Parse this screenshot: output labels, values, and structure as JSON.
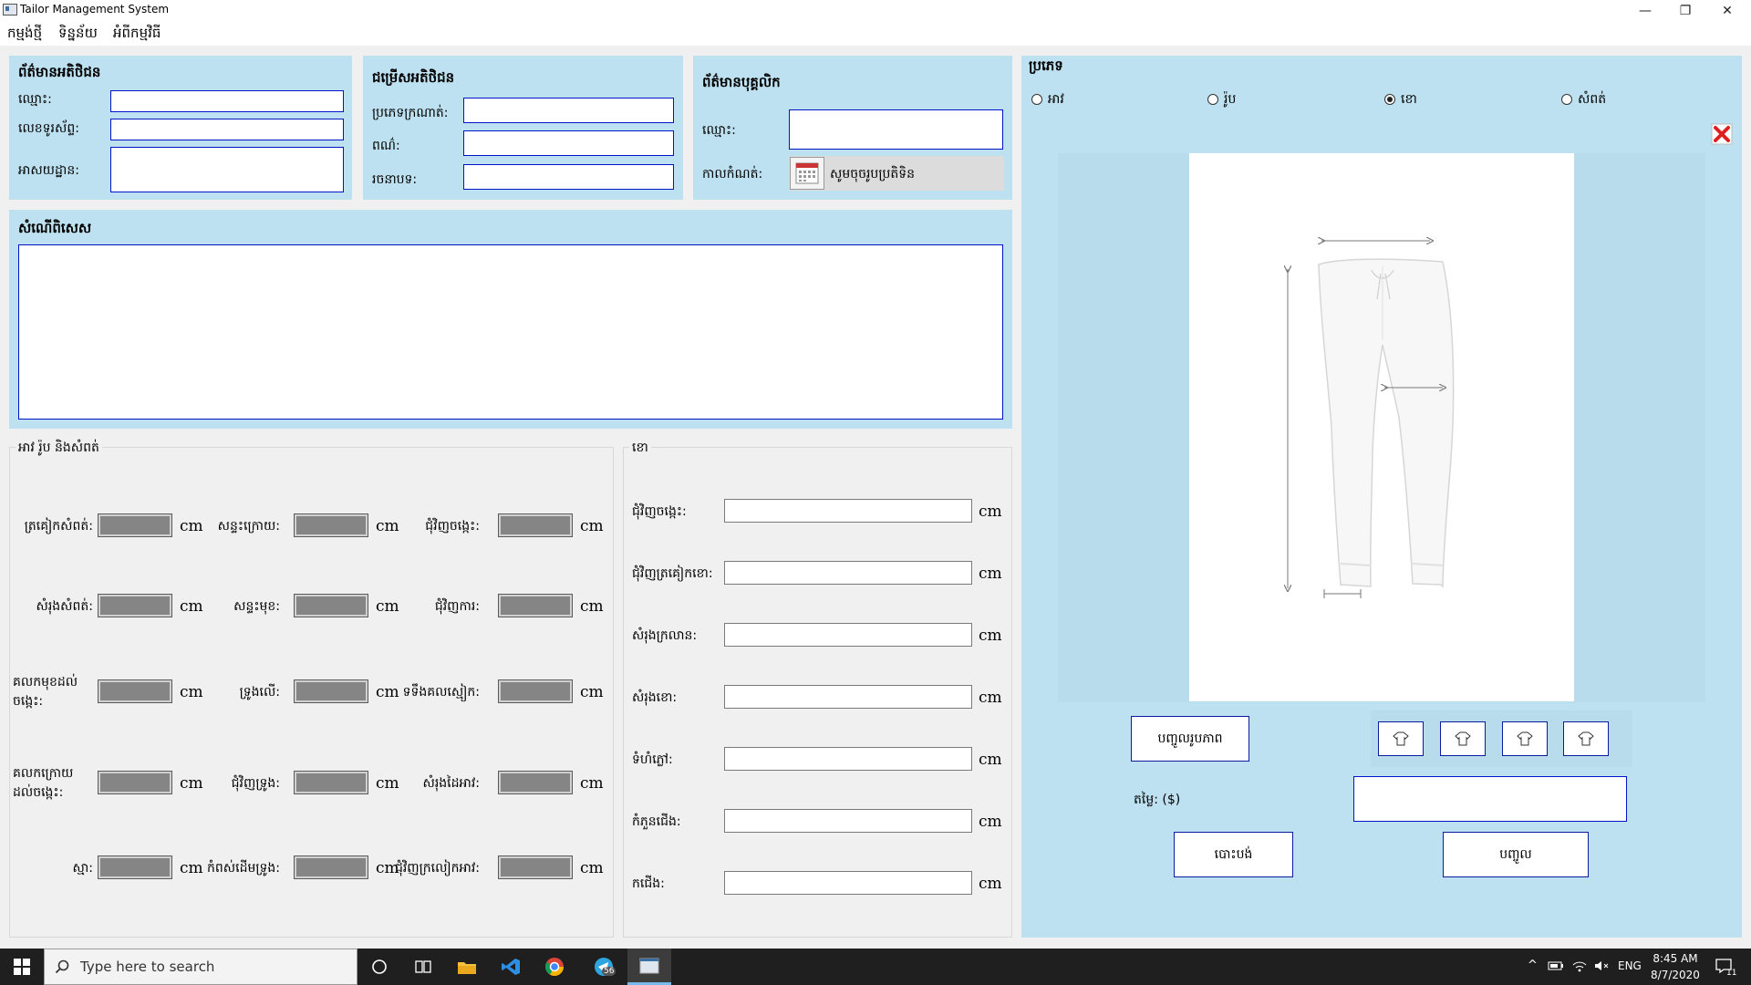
{
  "window": {
    "title": "Tailor Management System",
    "minimize": "—",
    "maximize": "❐",
    "close": "✕"
  },
  "menu": [
    "កម្មង់ថ្មី",
    "ទិន្នន័យ",
    "អំពីកម្មវិធី"
  ],
  "customer_info": {
    "title": "ព័ត៌មានអតិថិជន",
    "name_label": "ឈ្មោះ:",
    "phone_label": "លេខទូរស័ព្ទ:",
    "address_label": "អាសយដ្ឋាន:"
  },
  "customer_choice": {
    "title": "ជម្រើសអតិថិជន",
    "fabric_label": "ប្រភេទក្រណាត់:",
    "color_label": "ពណ៌:",
    "style_label": "រចនាបទ:"
  },
  "staff_info": {
    "title": "ព័ត៌មានបុគ្គលិក",
    "name_label": "ឈ្មោះ:",
    "date_label": "កាលកំណត់:",
    "date_placeholder": "សូមចុចរូបប្រតិទិន"
  },
  "special_request": {
    "title": "សំណើពិសេស"
  },
  "top_skirt_group": {
    "title": "អាវ រ៉ូប និងសំពត់",
    "unit": "cm",
    "rows": [
      [
        "ត្រគៀកសំពត់:",
        "សន្ទះក្រោយ:",
        "ជុំវិញចង្កេះ:"
      ],
      [
        "សំរុងសំពត់:",
        "សន្ទះមុខ:",
        "ជុំវិញការ:"
      ],
      [
        "គលកមុខដល់ចង្កេះ:",
        "ទ្រូងលើ:",
        "ទទឹងគលស្មៀក:"
      ],
      [
        "គលកក្រោយដល់ចង្កេះ:",
        "ជុំវិញទ្រូង:",
        "សំរុងដៃអាវ:"
      ],
      [
        "ស្មា:",
        "កំពស់ដើមទ្រូង:",
        "ជុំវិញក្រលៀកអាវ:"
      ]
    ]
  },
  "pants_group": {
    "title": "ខោ",
    "unit": "cm",
    "fields": [
      "ជុំវិញចង្កេះ:",
      "ជុំវិញត្រគៀកខោ:",
      "សំរុងក្រលាន:",
      "សំរុងខោ:",
      "ទំហំភ្លៅ:",
      "កំភួនជើង:",
      "កជើង:"
    ]
  },
  "garment": {
    "title": "ប្រភេទ",
    "options": [
      {
        "label": "អាវ",
        "selected": false
      },
      {
        "label": "រ៉ូប",
        "selected": false
      },
      {
        "label": "ខោ",
        "selected": true
      },
      {
        "label": "សំពត់",
        "selected": false
      }
    ],
    "photo_button": "បញ្ចូលរូបភាព",
    "price_label": "តម្លៃ: ($)",
    "cancel_button": "បោះបង់",
    "submit_button": "បញ្ចូល",
    "colors": {
      "panel": "#bde1f0",
      "close_icon": "#e02020"
    }
  },
  "taskbar": {
    "search_placeholder": "Type here to search",
    "time": "8:45 AM",
    "date": "8/7/2020",
    "lang": "ENG",
    "notif_count": "11",
    "telegram_badge": "56"
  }
}
